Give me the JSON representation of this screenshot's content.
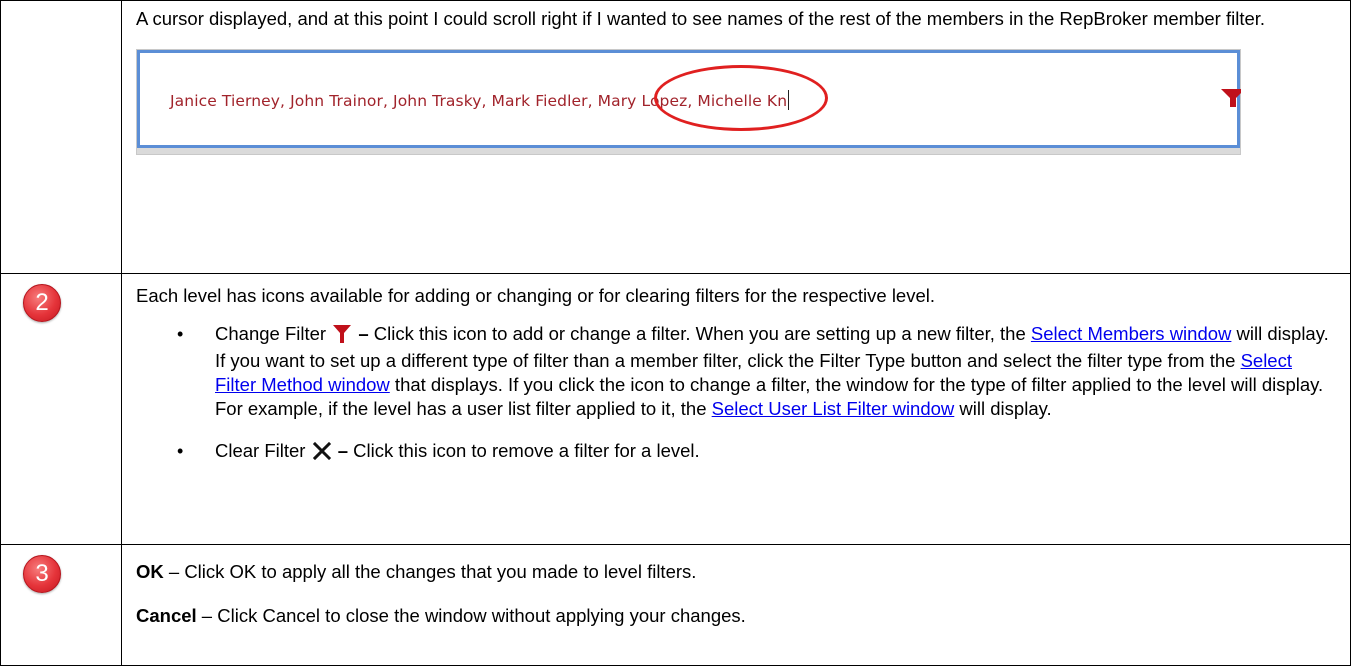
{
  "colors": {
    "badge": "#e5343a",
    "link": "#0000ee",
    "member_text": "#a1232b",
    "ellipse": "#e02020",
    "inset_border": "#5b8ed6",
    "filter_icon": "#c0101a"
  },
  "row1": {
    "text": "A cursor displayed, and at this point I could scroll right if I wanted to see names of the rest of the members in the RepBroker member filter.",
    "screenshot": {
      "member_filter_text": "Janice Tierney, John Trainor, John Trasky, Mark Fiedler, Mary Lopez, Michelle Kn",
      "icon": "filter-funnel-icon"
    }
  },
  "row2": {
    "number": "2",
    "intro": "Each level has icons available for adding or changing or for clearing filters for the respective level.",
    "bullet1": {
      "term": "Change Filter",
      "icon": "filter-funnel-icon",
      "dash": " –",
      "text_a": " Click this icon to add or change a filter. When you are setting up a new filter, the ",
      "link1": "Select Members window",
      "text_b": " will display. If you want to set up a different type of filter than a member filter, click the Filter Type button and select the filter type from the ",
      "link2": "Select Filter Method window",
      "text_c": " that displays. If you click the icon to change a filter, the window for the type of filter applied to the level will display. For example, if the level has a user list filter applied to it, the ",
      "link3": "Select User List Filter window",
      "text_d": " will display."
    },
    "bullet2": {
      "term": "Clear Filter",
      "icon": "clear-x-icon",
      "dash": " –",
      "text": " Click this icon to remove a filter for a level."
    }
  },
  "row3": {
    "number": "3",
    "ok_term": "OK",
    "ok_text": " – Click OK to apply all the changes that you made to level filters.",
    "cancel_term": "Cancel",
    "cancel_text": " – Click Cancel to close the window without applying your changes."
  }
}
